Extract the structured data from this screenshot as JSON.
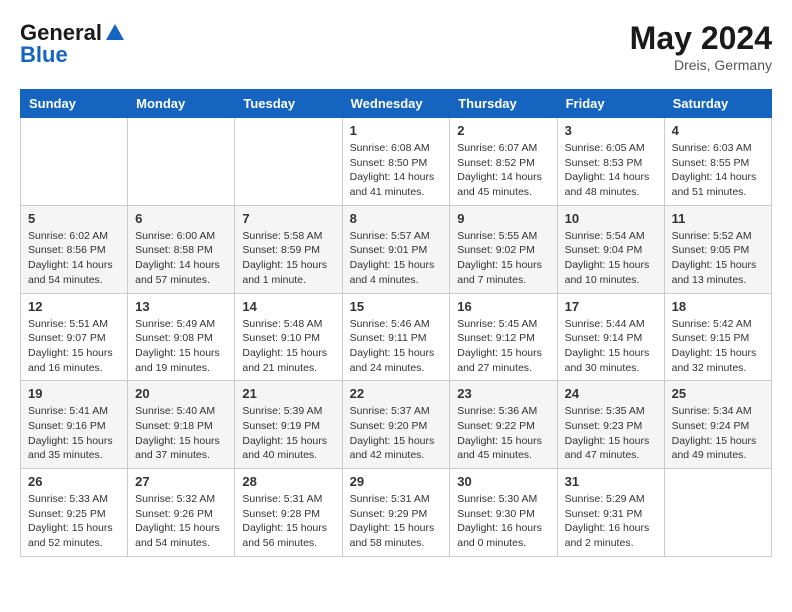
{
  "header": {
    "logo_general": "General",
    "logo_blue": "Blue",
    "month_year": "May 2024",
    "location": "Dreis, Germany"
  },
  "weekdays": [
    "Sunday",
    "Monday",
    "Tuesday",
    "Wednesday",
    "Thursday",
    "Friday",
    "Saturday"
  ],
  "weeks": [
    [
      {
        "day": "",
        "sunrise": "",
        "sunset": "",
        "daylight": ""
      },
      {
        "day": "",
        "sunrise": "",
        "sunset": "",
        "daylight": ""
      },
      {
        "day": "",
        "sunrise": "",
        "sunset": "",
        "daylight": ""
      },
      {
        "day": "1",
        "sunrise": "Sunrise: 6:08 AM",
        "sunset": "Sunset: 8:50 PM",
        "daylight": "Daylight: 14 hours and 41 minutes."
      },
      {
        "day": "2",
        "sunrise": "Sunrise: 6:07 AM",
        "sunset": "Sunset: 8:52 PM",
        "daylight": "Daylight: 14 hours and 45 minutes."
      },
      {
        "day": "3",
        "sunrise": "Sunrise: 6:05 AM",
        "sunset": "Sunset: 8:53 PM",
        "daylight": "Daylight: 14 hours and 48 minutes."
      },
      {
        "day": "4",
        "sunrise": "Sunrise: 6:03 AM",
        "sunset": "Sunset: 8:55 PM",
        "daylight": "Daylight: 14 hours and 51 minutes."
      }
    ],
    [
      {
        "day": "5",
        "sunrise": "Sunrise: 6:02 AM",
        "sunset": "Sunset: 8:56 PM",
        "daylight": "Daylight: 14 hours and 54 minutes."
      },
      {
        "day": "6",
        "sunrise": "Sunrise: 6:00 AM",
        "sunset": "Sunset: 8:58 PM",
        "daylight": "Daylight: 14 hours and 57 minutes."
      },
      {
        "day": "7",
        "sunrise": "Sunrise: 5:58 AM",
        "sunset": "Sunset: 8:59 PM",
        "daylight": "Daylight: 15 hours and 1 minute."
      },
      {
        "day": "8",
        "sunrise": "Sunrise: 5:57 AM",
        "sunset": "Sunset: 9:01 PM",
        "daylight": "Daylight: 15 hours and 4 minutes."
      },
      {
        "day": "9",
        "sunrise": "Sunrise: 5:55 AM",
        "sunset": "Sunset: 9:02 PM",
        "daylight": "Daylight: 15 hours and 7 minutes."
      },
      {
        "day": "10",
        "sunrise": "Sunrise: 5:54 AM",
        "sunset": "Sunset: 9:04 PM",
        "daylight": "Daylight: 15 hours and 10 minutes."
      },
      {
        "day": "11",
        "sunrise": "Sunrise: 5:52 AM",
        "sunset": "Sunset: 9:05 PM",
        "daylight": "Daylight: 15 hours and 13 minutes."
      }
    ],
    [
      {
        "day": "12",
        "sunrise": "Sunrise: 5:51 AM",
        "sunset": "Sunset: 9:07 PM",
        "daylight": "Daylight: 15 hours and 16 minutes."
      },
      {
        "day": "13",
        "sunrise": "Sunrise: 5:49 AM",
        "sunset": "Sunset: 9:08 PM",
        "daylight": "Daylight: 15 hours and 19 minutes."
      },
      {
        "day": "14",
        "sunrise": "Sunrise: 5:48 AM",
        "sunset": "Sunset: 9:10 PM",
        "daylight": "Daylight: 15 hours and 21 minutes."
      },
      {
        "day": "15",
        "sunrise": "Sunrise: 5:46 AM",
        "sunset": "Sunset: 9:11 PM",
        "daylight": "Daylight: 15 hours and 24 minutes."
      },
      {
        "day": "16",
        "sunrise": "Sunrise: 5:45 AM",
        "sunset": "Sunset: 9:12 PM",
        "daylight": "Daylight: 15 hours and 27 minutes."
      },
      {
        "day": "17",
        "sunrise": "Sunrise: 5:44 AM",
        "sunset": "Sunset: 9:14 PM",
        "daylight": "Daylight: 15 hours and 30 minutes."
      },
      {
        "day": "18",
        "sunrise": "Sunrise: 5:42 AM",
        "sunset": "Sunset: 9:15 PM",
        "daylight": "Daylight: 15 hours and 32 minutes."
      }
    ],
    [
      {
        "day": "19",
        "sunrise": "Sunrise: 5:41 AM",
        "sunset": "Sunset: 9:16 PM",
        "daylight": "Daylight: 15 hours and 35 minutes."
      },
      {
        "day": "20",
        "sunrise": "Sunrise: 5:40 AM",
        "sunset": "Sunset: 9:18 PM",
        "daylight": "Daylight: 15 hours and 37 minutes."
      },
      {
        "day": "21",
        "sunrise": "Sunrise: 5:39 AM",
        "sunset": "Sunset: 9:19 PM",
        "daylight": "Daylight: 15 hours and 40 minutes."
      },
      {
        "day": "22",
        "sunrise": "Sunrise: 5:37 AM",
        "sunset": "Sunset: 9:20 PM",
        "daylight": "Daylight: 15 hours and 42 minutes."
      },
      {
        "day": "23",
        "sunrise": "Sunrise: 5:36 AM",
        "sunset": "Sunset: 9:22 PM",
        "daylight": "Daylight: 15 hours and 45 minutes."
      },
      {
        "day": "24",
        "sunrise": "Sunrise: 5:35 AM",
        "sunset": "Sunset: 9:23 PM",
        "daylight": "Daylight: 15 hours and 47 minutes."
      },
      {
        "day": "25",
        "sunrise": "Sunrise: 5:34 AM",
        "sunset": "Sunset: 9:24 PM",
        "daylight": "Daylight: 15 hours and 49 minutes."
      }
    ],
    [
      {
        "day": "26",
        "sunrise": "Sunrise: 5:33 AM",
        "sunset": "Sunset: 9:25 PM",
        "daylight": "Daylight: 15 hours and 52 minutes."
      },
      {
        "day": "27",
        "sunrise": "Sunrise: 5:32 AM",
        "sunset": "Sunset: 9:26 PM",
        "daylight": "Daylight: 15 hours and 54 minutes."
      },
      {
        "day": "28",
        "sunrise": "Sunrise: 5:31 AM",
        "sunset": "Sunset: 9:28 PM",
        "daylight": "Daylight: 15 hours and 56 minutes."
      },
      {
        "day": "29",
        "sunrise": "Sunrise: 5:31 AM",
        "sunset": "Sunset: 9:29 PM",
        "daylight": "Daylight: 15 hours and 58 minutes."
      },
      {
        "day": "30",
        "sunrise": "Sunrise: 5:30 AM",
        "sunset": "Sunset: 9:30 PM",
        "daylight": "Daylight: 16 hours and 0 minutes."
      },
      {
        "day": "31",
        "sunrise": "Sunrise: 5:29 AM",
        "sunset": "Sunset: 9:31 PM",
        "daylight": "Daylight: 16 hours and 2 minutes."
      },
      {
        "day": "",
        "sunrise": "",
        "sunset": "",
        "daylight": ""
      }
    ]
  ]
}
